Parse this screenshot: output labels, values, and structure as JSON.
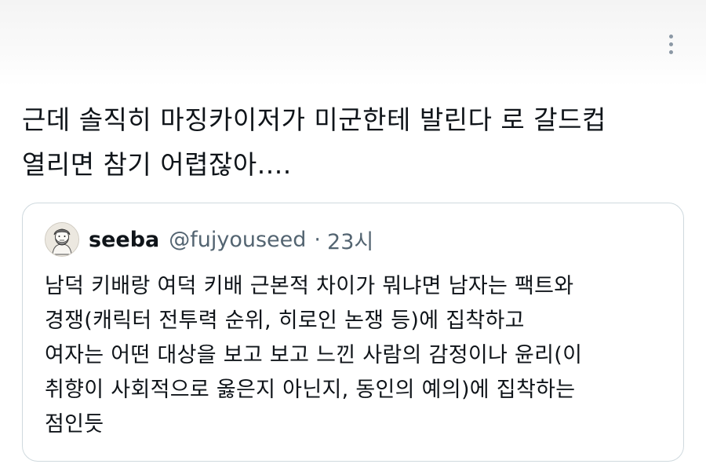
{
  "tweet": {
    "text": "근데 솔직히 마징카이저가 미군한테 발린다 로 갈드컵\n열리면 참기 어렵잖아....",
    "more_icon": "more-vertical-icon"
  },
  "quoted_tweet": {
    "display_name": "seeba",
    "handle": "@fujyouseed",
    "separator": "·",
    "time": "23시",
    "avatar_icon": "avatar-illustration",
    "text": "남덕 키배랑 여덕 키배 근본적 차이가 뭐냐면 남자는 팩트와\n경쟁(캐릭터 전투력 순위, 히로인 논쟁 등)에 집착하고\n여자는 어떤 대상을 보고 보고 느낀 사람의 감정이나 윤리(이\n취향이 사회적으로 옳은지 아닌지, 동인의 예의)에 집착하는\n점인듯"
  },
  "colors": {
    "text_primary": "#0f1419",
    "text_secondary": "#536471",
    "border": "#cfd9de"
  }
}
